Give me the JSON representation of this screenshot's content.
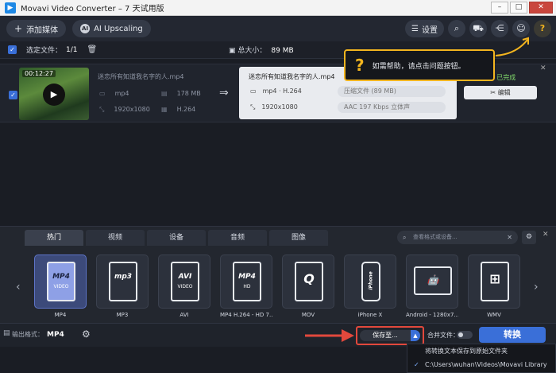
{
  "window": {
    "title": "Movavi Video Converter – 7 天试用版",
    "buttons": [
      "–",
      "□",
      "✕"
    ]
  },
  "toolbar": {
    "add_media": "添加媒体",
    "ai_badge": "AI",
    "ai_upscaling": "AI Upscaling",
    "settings": "设置"
  },
  "selection": {
    "selected_label": "选定文件：",
    "selected_count": "1/1",
    "total_label": "总大小：",
    "total_value": "89 MB"
  },
  "file": {
    "duration": "00:12:27",
    "source_name": "迷恋所有知道我名字的人.mp4",
    "format": "mp4",
    "size": "178 MB",
    "resolution": "1920x1080",
    "codec": "H.264"
  },
  "output": {
    "name": "迷恋所有知道我名字的人.mp4",
    "format": "mp4 · H.264",
    "resolution": "1920x1080",
    "compress": "压缩文件 (89 MB)",
    "audio": "AAC 197 Kbps 立体声",
    "status": "已完成",
    "edit_label": "编辑"
  },
  "help_popup": {
    "text": "如需帮助，请点击问题按钮。"
  },
  "format_panel": {
    "tabs": [
      "热门",
      "视频",
      "设备",
      "音频",
      "图像"
    ],
    "active_tab": 0,
    "search_placeholder": "查看格式或设备...",
    "formats": [
      {
        "label": "MP4",
        "icon_text": "MP4",
        "sub": "VIDEO",
        "selected": true
      },
      {
        "label": "MP3",
        "icon_text": "mp3",
        "sub": "",
        "selected": false
      },
      {
        "label": "AVI",
        "icon_text": "AVI",
        "sub": "VIDEO",
        "selected": false
      },
      {
        "label": "MP4 H.264 - HD 7...",
        "icon_text": "MP4",
        "sub": "HD",
        "selected": false
      },
      {
        "label": "MOV",
        "icon_text": "",
        "sub": "",
        "selected": false
      },
      {
        "label": "iPhone X",
        "icon_text": "iPhone",
        "sub": "",
        "selected": false
      },
      {
        "label": "Android - 1280x7...",
        "icon_text": "",
        "sub": "",
        "selected": false
      },
      {
        "label": "WMV",
        "icon_text": "",
        "sub": "",
        "selected": false
      }
    ]
  },
  "bottom": {
    "output_format_label": "输出格式：",
    "output_format_value": "MP4",
    "save_to": "保存至...",
    "merge_label": "合并文件：",
    "convert": "转换"
  },
  "dropdown": {
    "items": [
      "将转换文本保存到原始文件夹",
      "C:\\Users\\wuhan\\Videos\\Movavi Library"
    ],
    "checked_index": 1
  },
  "colors": {
    "accent": "#3a6fd8",
    "help": "#f3b51f",
    "highlight": "#e2483c",
    "done": "#7fd66a"
  }
}
